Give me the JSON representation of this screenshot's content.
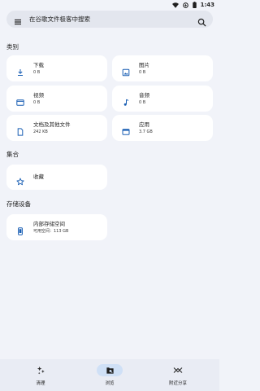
{
  "status": {
    "time": "1:43"
  },
  "search": {
    "placeholder": "在谷歌文件极客中搜索"
  },
  "sections": {
    "categories": "类别",
    "collections": "集合",
    "storage": "存储设备"
  },
  "categories": [
    {
      "title": "下载",
      "sub": "0 B",
      "icon": "download-icon"
    },
    {
      "title": "图片",
      "sub": "0 B",
      "icon": "image-icon"
    },
    {
      "title": "视频",
      "sub": "0 B",
      "icon": "video-icon"
    },
    {
      "title": "音频",
      "sub": "0 B",
      "icon": "music-icon"
    },
    {
      "title": "文档及其他文件",
      "sub": "242 KB",
      "icon": "document-icon"
    },
    {
      "title": "应用",
      "sub": "3.7 GB",
      "icon": "app-icon"
    }
  ],
  "collections": [
    {
      "title": "收藏",
      "icon": "star-icon"
    }
  ],
  "storage": {
    "title": "内部存储空间",
    "sub": "可用空间：113 GB",
    "icon": "phone-icon"
  },
  "nav": [
    {
      "label": "清理",
      "icon": "sparkle-icon",
      "active": false
    },
    {
      "label": "浏览",
      "icon": "browse-icon",
      "active": true
    },
    {
      "label": "附近分享",
      "icon": "nearby-share-icon",
      "active": false
    }
  ],
  "colors": {
    "accent": "#1a5fb4",
    "background": "#f1f3f9",
    "card": "#ffffff",
    "active_pill": "#cfe0f6"
  }
}
